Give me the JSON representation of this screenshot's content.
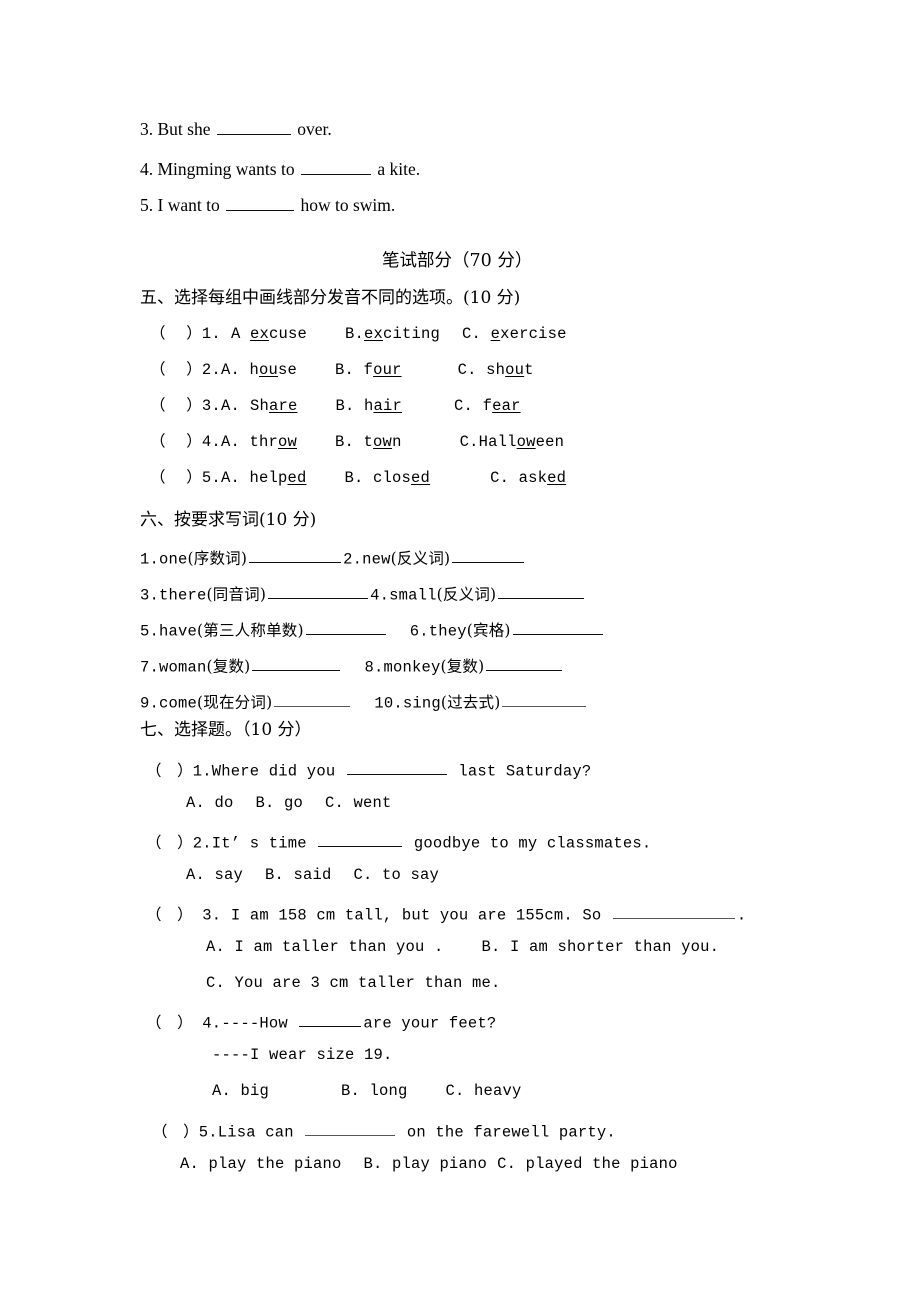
{
  "document": {
    "type": "exam-paper",
    "language": "zh-CN / en",
    "page_background": "#ffffff",
    "text_color": "#000000"
  },
  "carryover": {
    "items": [
      {
        "num": "3.",
        "before": "But she",
        "after": "over."
      },
      {
        "num": "4.",
        "before": "Mingming wants to",
        "after": "a kite."
      },
      {
        "num": "5.",
        "before": "I want to",
        "after": "how to swim."
      }
    ]
  },
  "written_part": {
    "title": "笔试部分（70 分）"
  },
  "section_five": {
    "heading": "五、选择每组中画线部分发音不同的选项。(10 分)",
    "bracket": "（    ）",
    "items": [
      {
        "num": "1.",
        "options": [
          {
            "label": "A",
            "pre": "",
            "mark": "ex",
            "post": "cuse"
          },
          {
            "label": "B.",
            "pre": "",
            "mark": "ex",
            "post": "citing"
          },
          {
            "label": "C.",
            "pre": "",
            "mark": "e",
            "post": "xercise"
          }
        ]
      },
      {
        "num": "2.",
        "options": [
          {
            "label": "A.",
            "pre": "h",
            "mark": "ou",
            "post": "se"
          },
          {
            "label": "B.",
            "pre": "f",
            "mark": "our",
            "post": ""
          },
          {
            "label": "C.",
            "pre": "sh",
            "mark": "ou",
            "post": "t"
          }
        ]
      },
      {
        "num": "3.",
        "options": [
          {
            "label": "A.",
            "pre": "Sh",
            "mark": "are",
            "post": ""
          },
          {
            "label": "B.",
            "pre": "h",
            "mark": "air",
            "post": ""
          },
          {
            "label": "C.",
            "pre": "f",
            "mark": "ear",
            "post": ""
          }
        ]
      },
      {
        "num": "4.",
        "options": [
          {
            "label": "A.",
            "pre": "thr",
            "mark": "ow",
            "post": ""
          },
          {
            "label": "B.",
            "pre": "t",
            "mark": "ow",
            "post": "n"
          },
          {
            "label": "C.",
            "pre": "Hall",
            "mark": "ow",
            "post": "een"
          }
        ]
      },
      {
        "num": "5.",
        "options": [
          {
            "label": "A.",
            "pre": "help",
            "mark": "ed",
            "post": ""
          },
          {
            "label": "B.",
            "pre": "clos",
            "mark": "ed",
            "post": ""
          },
          {
            "label": "C.",
            "pre": "ask",
            "mark": "ed",
            "post": ""
          }
        ]
      }
    ]
  },
  "section_six": {
    "heading": "六、按要求写词(10 分)",
    "items": [
      {
        "num": "1.",
        "word": "one",
        "hint": "(序数词)"
      },
      {
        "num": "2.",
        "word": "new",
        "hint": "(反义词)"
      },
      {
        "num": "3.",
        "word": "there",
        "hint": "(同音词)"
      },
      {
        "num": "4.",
        "word": "small",
        "hint": "(反义词)"
      },
      {
        "num": "5.",
        "word": "have",
        "hint": "(第三人称单数)"
      },
      {
        "num": "6.",
        "word": "they",
        "hint": "(宾格)"
      },
      {
        "num": "7.",
        "word": "woman",
        "hint": "(复数)"
      },
      {
        "num": "8.",
        "word": "monkey",
        "hint": "(复数)"
      },
      {
        "num": "9.",
        "word": "come",
        "hint": "(现在分词)"
      },
      {
        "num": "10.",
        "word": "sing",
        "hint": "(过去式)"
      }
    ]
  },
  "section_seven": {
    "heading": "七、选择题。（10 分）",
    "bracket": "（   ）",
    "items": [
      {
        "num": "1.",
        "stem_before": "Where did you",
        "stem_after": "last Saturday?",
        "choices": [
          "A. do",
          "B. go",
          "C. went"
        ]
      },
      {
        "num": "2.",
        "stem_before": "It’ s time",
        "stem_after": "goodbye to my classmates.",
        "choices": [
          "A. say",
          "B. said",
          "C. to say"
        ]
      },
      {
        "num": "3.",
        "stem_before": "I am 158 cm tall, but you are 155cm. So",
        "stem_after": ".",
        "choices": [
          "A. I am taller than you .",
          "B. I am shorter than you.",
          "C. You are 3 cm taller than me."
        ]
      },
      {
        "num": "4.",
        "stem_before": "----How",
        "stem_after": "are your feet?",
        "stem_line2": "----I wear size 19.",
        "choices": [
          "A. big",
          "B. long",
          "C. heavy"
        ]
      },
      {
        "num": "5.",
        "stem_before": "Lisa can",
        "stem_after": "on the farewell party.",
        "choices": [
          "A. play the piano",
          "B. play piano",
          "C. played the piano"
        ]
      }
    ]
  }
}
